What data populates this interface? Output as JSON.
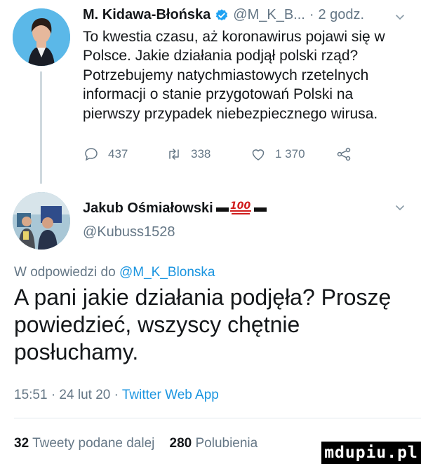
{
  "parent_tweet": {
    "author_name": "M. Kidawa-Błońska",
    "handle": "@M_K_B...",
    "separator": "·",
    "time": "2 godz.",
    "text": "To kwestia czasu, aż koronawirus pojawi się w Polsce. Jakie działania podjął polski rząd? Potrzebujemy natychmiastowych rzetelnych informacji o stanie przygotowań Polski na pierwszy przypadek niebezpiecznego wirusa.",
    "replies": "437",
    "retweets": "338",
    "likes": "1 370"
  },
  "reply_tweet": {
    "author_name": "Jakub Ośmiałowski",
    "handle": "@Kubuss1528",
    "replying_prefix": "W odpowiedzi do",
    "replying_to": "@M_K_Blonska",
    "text": "A pani jakie działania podjęła? Proszę powiedzieć, wszyscy chętnie posłuchamy.",
    "timestamp": "15:51 · 24 lut 20 ·",
    "source": "Twitter Web App",
    "retweet_count": "32",
    "retweet_label": "Tweety podane dalej",
    "like_count": "280",
    "like_label": "Polubienia"
  },
  "watermark": "mdupiu.pl",
  "colors": {
    "text": "#14171a",
    "secondary": "#657786",
    "link": "#1b95e0",
    "verified": "#1da1f2"
  },
  "icons": [
    "verified-badge-icon",
    "chevron-down-icon",
    "reply-icon",
    "retweet-icon",
    "like-icon",
    "share-icon",
    "hundred-points-emoji-icon"
  ]
}
